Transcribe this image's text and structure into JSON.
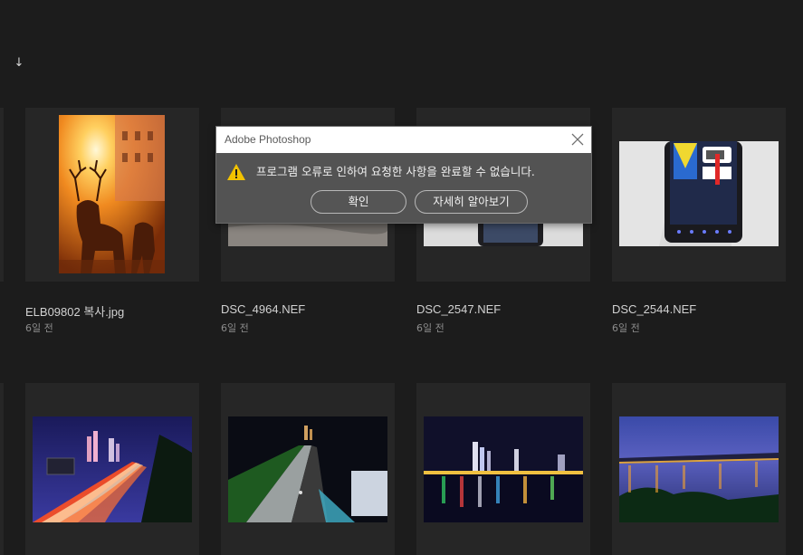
{
  "toolbar": {
    "sort_icon": "arrow-down-icon",
    "sort_glyph": "↓"
  },
  "files": [
    {
      "name": "ELB09802 복사.jpg",
      "date": "6일 전"
    },
    {
      "name": "DSC_4964.NEF",
      "date": "6일 전"
    },
    {
      "name": "DSC_2547.NEF",
      "date": "6일 전"
    },
    {
      "name": "DSC_2544.NEF",
      "date": "6일 전"
    },
    {
      "name": "",
      "date": ""
    },
    {
      "name": "",
      "date": ""
    },
    {
      "name": "",
      "date": ""
    },
    {
      "name": "",
      "date": ""
    }
  ],
  "dialog": {
    "title": "Adobe Photoshop",
    "message": "프로그램 오류로 인하여 요청한 사항을 완료할 수 없습니다.",
    "ok_label": "확인",
    "more_label": "자세히 알아보기",
    "icons": {
      "warning": "warning-icon",
      "close": "close-icon"
    }
  },
  "colors": {
    "background": "#1c1c1c",
    "card": "#262626",
    "dialog_body": "#535353",
    "warning": "#f2c200"
  }
}
